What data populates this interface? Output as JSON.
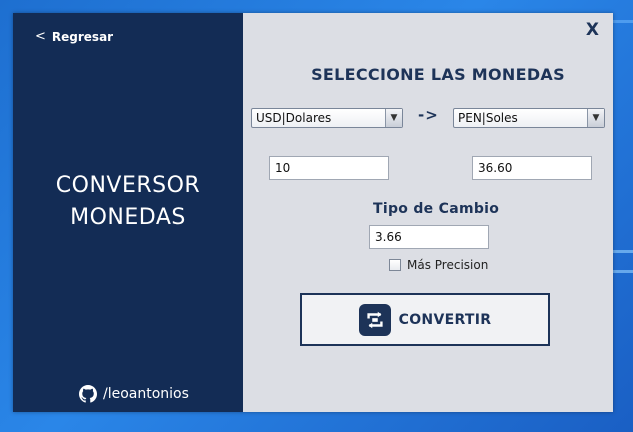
{
  "sidebar": {
    "back_arrow": "<",
    "back_label": "Regresar",
    "title_line1": "CONVERSOR",
    "title_line2": "MONEDAS",
    "github_handle": "/leoantonios"
  },
  "main": {
    "close_label": "X",
    "heading": "SELECCIONE LAS MONEDAS",
    "from_currency": "USD|Dolares",
    "arrow_text": "->",
    "to_currency": "PEN|Soles",
    "amount_value": "10",
    "result_value": "36.60",
    "rate_label": "Tipo de Cambio",
    "rate_value": "3.66",
    "precision_label": "Más Precision",
    "precision_checked": false,
    "convert_label": "CONVERTIR"
  },
  "colors": {
    "sidebar_bg": "#132c55",
    "panel_bg": "#dcdee4",
    "accent": "#1d3358",
    "desktop_bg": "#1e6fd0"
  },
  "icons": {
    "back": "chevron-left-icon",
    "github": "github-icon",
    "select_arrow": "triangle-down-icon",
    "convert": "convert-arrows-icon",
    "close": "close-icon"
  }
}
